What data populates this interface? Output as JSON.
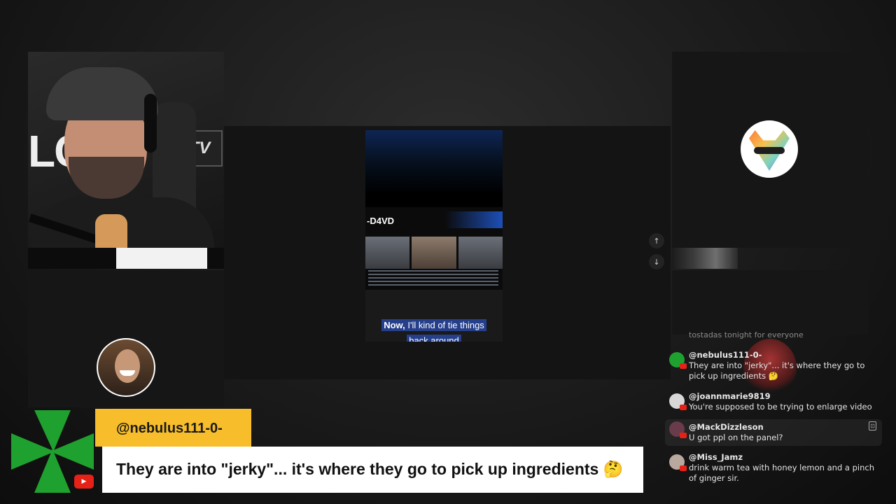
{
  "host_cam": {
    "wall_text": "LC",
    "tv_logo": "TV"
  },
  "center_video": {
    "logo": "-D4VD",
    "caption_highlight": "Now,",
    "caption_rest": " I'll kind of tie things",
    "caption_line2": "back around"
  },
  "controls": {
    "up_arrow": "↑",
    "down_arrow": "↓"
  },
  "lower_third": {
    "username": "@nebulus111-0-",
    "message": "They are into \"jerky\"... it's where they go to pick up ingredients 🤔",
    "yt_label": "▶"
  },
  "chat": {
    "partial_line": "tostadas tonight for everyone",
    "messages": [
      {
        "user": "@nebulus111-0-",
        "text": "They are into \"jerky\"... it's where they go to pick up ingredients 🤔"
      },
      {
        "user": "@joannmarie9819",
        "text": "You're supposed to be trying to enlarge video"
      },
      {
        "user": "@MackDizzleson",
        "text": "U got ppl on the panel?"
      },
      {
        "user": "@Miss_Jamz",
        "text": "drink warm tea with honey lemon and a pinch of ginger sir."
      }
    ],
    "pin_icon": "⊡"
  },
  "colors": {
    "lower_third_name_bg": "#f7bd2a",
    "lower_third_msg_bg": "#ffffff",
    "accent_green": "#1fa12f",
    "youtube_red": "#e62117"
  }
}
